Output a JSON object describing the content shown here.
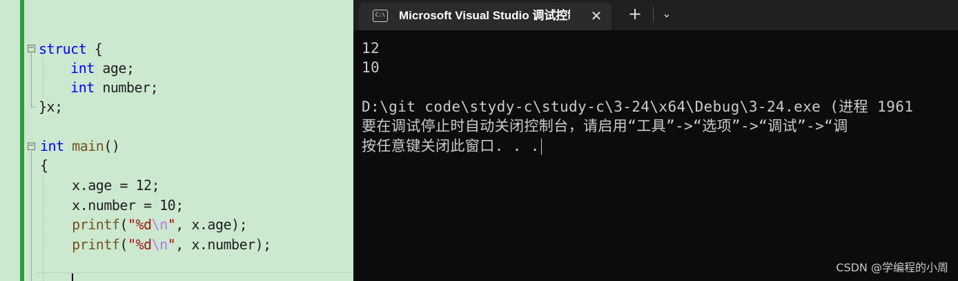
{
  "editor": {
    "lines": [
      {
        "tokens": [
          {
            "t": "struct",
            "c": "kw"
          },
          {
            "t": " {",
            "c": ""
          }
        ]
      },
      {
        "tokens": [
          {
            "t": "    ",
            "c": ""
          },
          {
            "t": "int",
            "c": "kw"
          },
          {
            "t": " age;",
            "c": ""
          }
        ]
      },
      {
        "tokens": [
          {
            "t": "    ",
            "c": ""
          },
          {
            "t": "int",
            "c": "kw"
          },
          {
            "t": " number;",
            "c": ""
          }
        ]
      },
      {
        "tokens": [
          {
            "t": "}x;",
            "c": ""
          }
        ]
      },
      {
        "tokens": [
          {
            "t": "int",
            "c": "kw"
          },
          {
            "t": " ",
            "c": ""
          },
          {
            "t": "main",
            "c": "fn"
          },
          {
            "t": "()",
            "c": ""
          }
        ]
      },
      {
        "tokens": [
          {
            "t": "{",
            "c": ""
          }
        ]
      },
      {
        "tokens": [
          {
            "t": "    x.age = 12;",
            "c": ""
          }
        ]
      },
      {
        "tokens": [
          {
            "t": "    x.number = 10;",
            "c": ""
          }
        ]
      },
      {
        "tokens": [
          {
            "t": "    ",
            "c": ""
          },
          {
            "t": "printf",
            "c": "fn"
          },
          {
            "t": "(",
            "c": ""
          },
          {
            "t": "\"%d",
            "c": "str"
          },
          {
            "t": "\\n",
            "c": "esc"
          },
          {
            "t": "\"",
            "c": "str"
          },
          {
            "t": ", x.age);",
            "c": ""
          }
        ]
      },
      {
        "tokens": [
          {
            "t": "    ",
            "c": ""
          },
          {
            "t": "printf",
            "c": "fn"
          },
          {
            "t": "(",
            "c": ""
          },
          {
            "t": "\"%d",
            "c": "str"
          },
          {
            "t": "\\n",
            "c": "esc"
          },
          {
            "t": "\"",
            "c": "str"
          },
          {
            "t": ", x.number);",
            "c": ""
          }
        ]
      }
    ]
  },
  "terminal": {
    "tab_icon": "C:\\",
    "tab_title": "Microsoft Visual Studio 调试控制台",
    "close_glyph": "✕",
    "new_tab_glyph": "+",
    "dropdown_glyph": "⌄",
    "console_lines": [
      "12",
      "10",
      "",
      "D:\\git code\\stydy-c\\study-c\\3-24\\x64\\Debug\\3-24.exe (进程 1961",
      "要在调试停止时自动关闭控制台，请启用“工具”->“选项”->“调试”->“调",
      "按任意键关闭此窗口. . ."
    ]
  },
  "watermark": "CSDN @学编程的小周",
  "colors": {
    "editor_bg": "#cce8cf",
    "change_bar": "#2e9c3a",
    "keyword": "#0000ff",
    "function": "#74531f",
    "string": "#a31515",
    "escape": "#b776fb",
    "terminal_bg": "#0c0c0c",
    "tabbar_bg": "#202020",
    "tab_active_bg": "#2b2b2b",
    "console_text": "#cccccc"
  }
}
